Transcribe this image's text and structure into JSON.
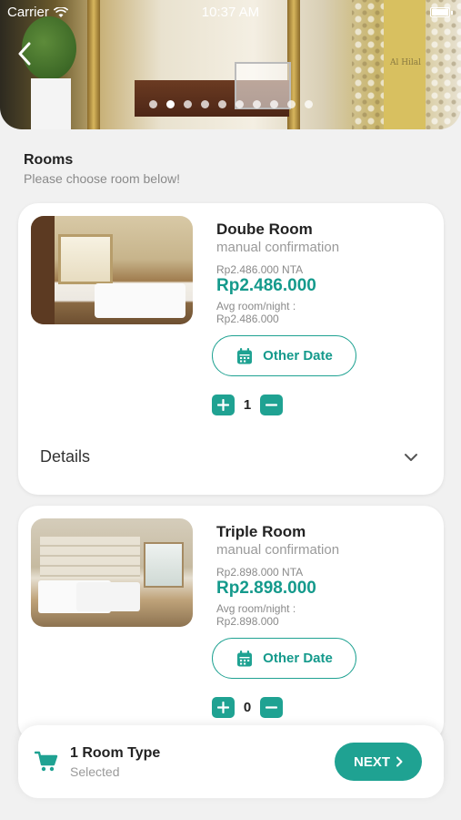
{
  "status_bar": {
    "carrier": "Carrier",
    "time": "10:37 AM"
  },
  "hero": {
    "sign_text": "Al Hilal",
    "slides": 10,
    "active_slide": 1
  },
  "section": {
    "title": "Rooms",
    "subtitle": "Please choose room below!"
  },
  "rooms": [
    {
      "name": "Doube Room",
      "confirmation": "manual confirmation",
      "nta": "Rp2.486.000 NTA",
      "price": "Rp2.486.000",
      "avg_label": "Avg room/night :",
      "avg_price": "Rp2.486.000",
      "other_date_label": "Other Date",
      "quantity": "1",
      "details_label": "Details"
    },
    {
      "name": "Triple Room",
      "confirmation": "manual confirmation",
      "nta": "Rp2.898.000 NTA",
      "price": "Rp2.898.000",
      "avg_label": "Avg room/night :",
      "avg_price": "Rp2.898.000",
      "other_date_label": "Other Date",
      "quantity": "0"
    }
  ],
  "bottom_bar": {
    "title": "1 Room Type",
    "subtitle": "Selected",
    "next_label": "NEXT"
  },
  "colors": {
    "accent": "#1fa292",
    "price": "#159a8c"
  }
}
